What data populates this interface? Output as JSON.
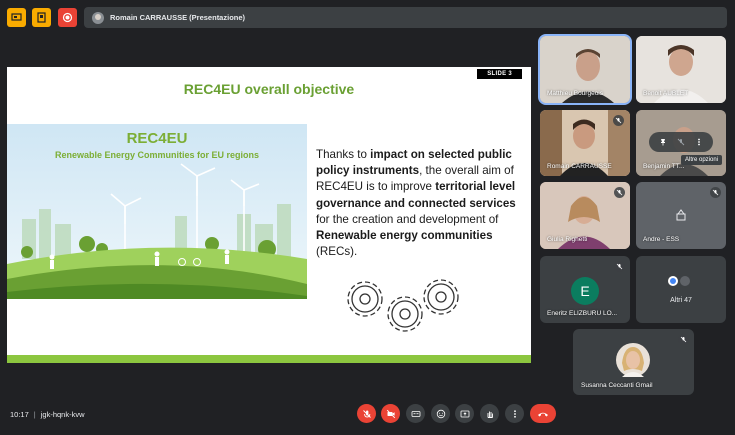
{
  "top_bar": {
    "presenter_label": "Romain CARRAUSSE (Presentazione)"
  },
  "slide": {
    "number_label": "SLIDE 3",
    "title": "REC4EU overall objective",
    "illustration_title": "REC4EU",
    "illustration_subtitle": "Renewable Energy Communities for EU regions",
    "text": {
      "p1": "Thanks to ",
      "b1": "impact on selected public policy instruments",
      "p2": ", the overall aim of REC4EU is to improve ",
      "b2": "territorial level governance and connected services",
      "p3": " for the creation and development of ",
      "b3": "Renewable energy communities",
      "p4": " (RECs)."
    }
  },
  "participants": [
    {
      "name": "Matthieu Bourgeois"
    },
    {
      "name": "Benoit AUBLET"
    },
    {
      "name": "Romain CARRAUSSE"
    },
    {
      "name": "Benjamin TT..."
    },
    {
      "name": "Giulia Righetti"
    },
    {
      "name": "Andre - ESS"
    },
    {
      "name": "Eneritz ELIZBURU LO...",
      "initial": "E"
    },
    {
      "name": "Altri 47"
    },
    {
      "name": "Susanna Ceccanti Gmail"
    }
  ],
  "tile_hover": {
    "tooltip": "Altre opzioni"
  },
  "bottom_bar": {
    "time": "10:17",
    "meeting_code": "jgk-hqnk-kvw"
  },
  "colors": {
    "background": "#202124",
    "tile": "#3c4043",
    "danger": "#ea4335",
    "brand_green": "#7cae35",
    "accent_yellow": "#fbbc04",
    "speaking_blue": "#8ab4f8"
  }
}
